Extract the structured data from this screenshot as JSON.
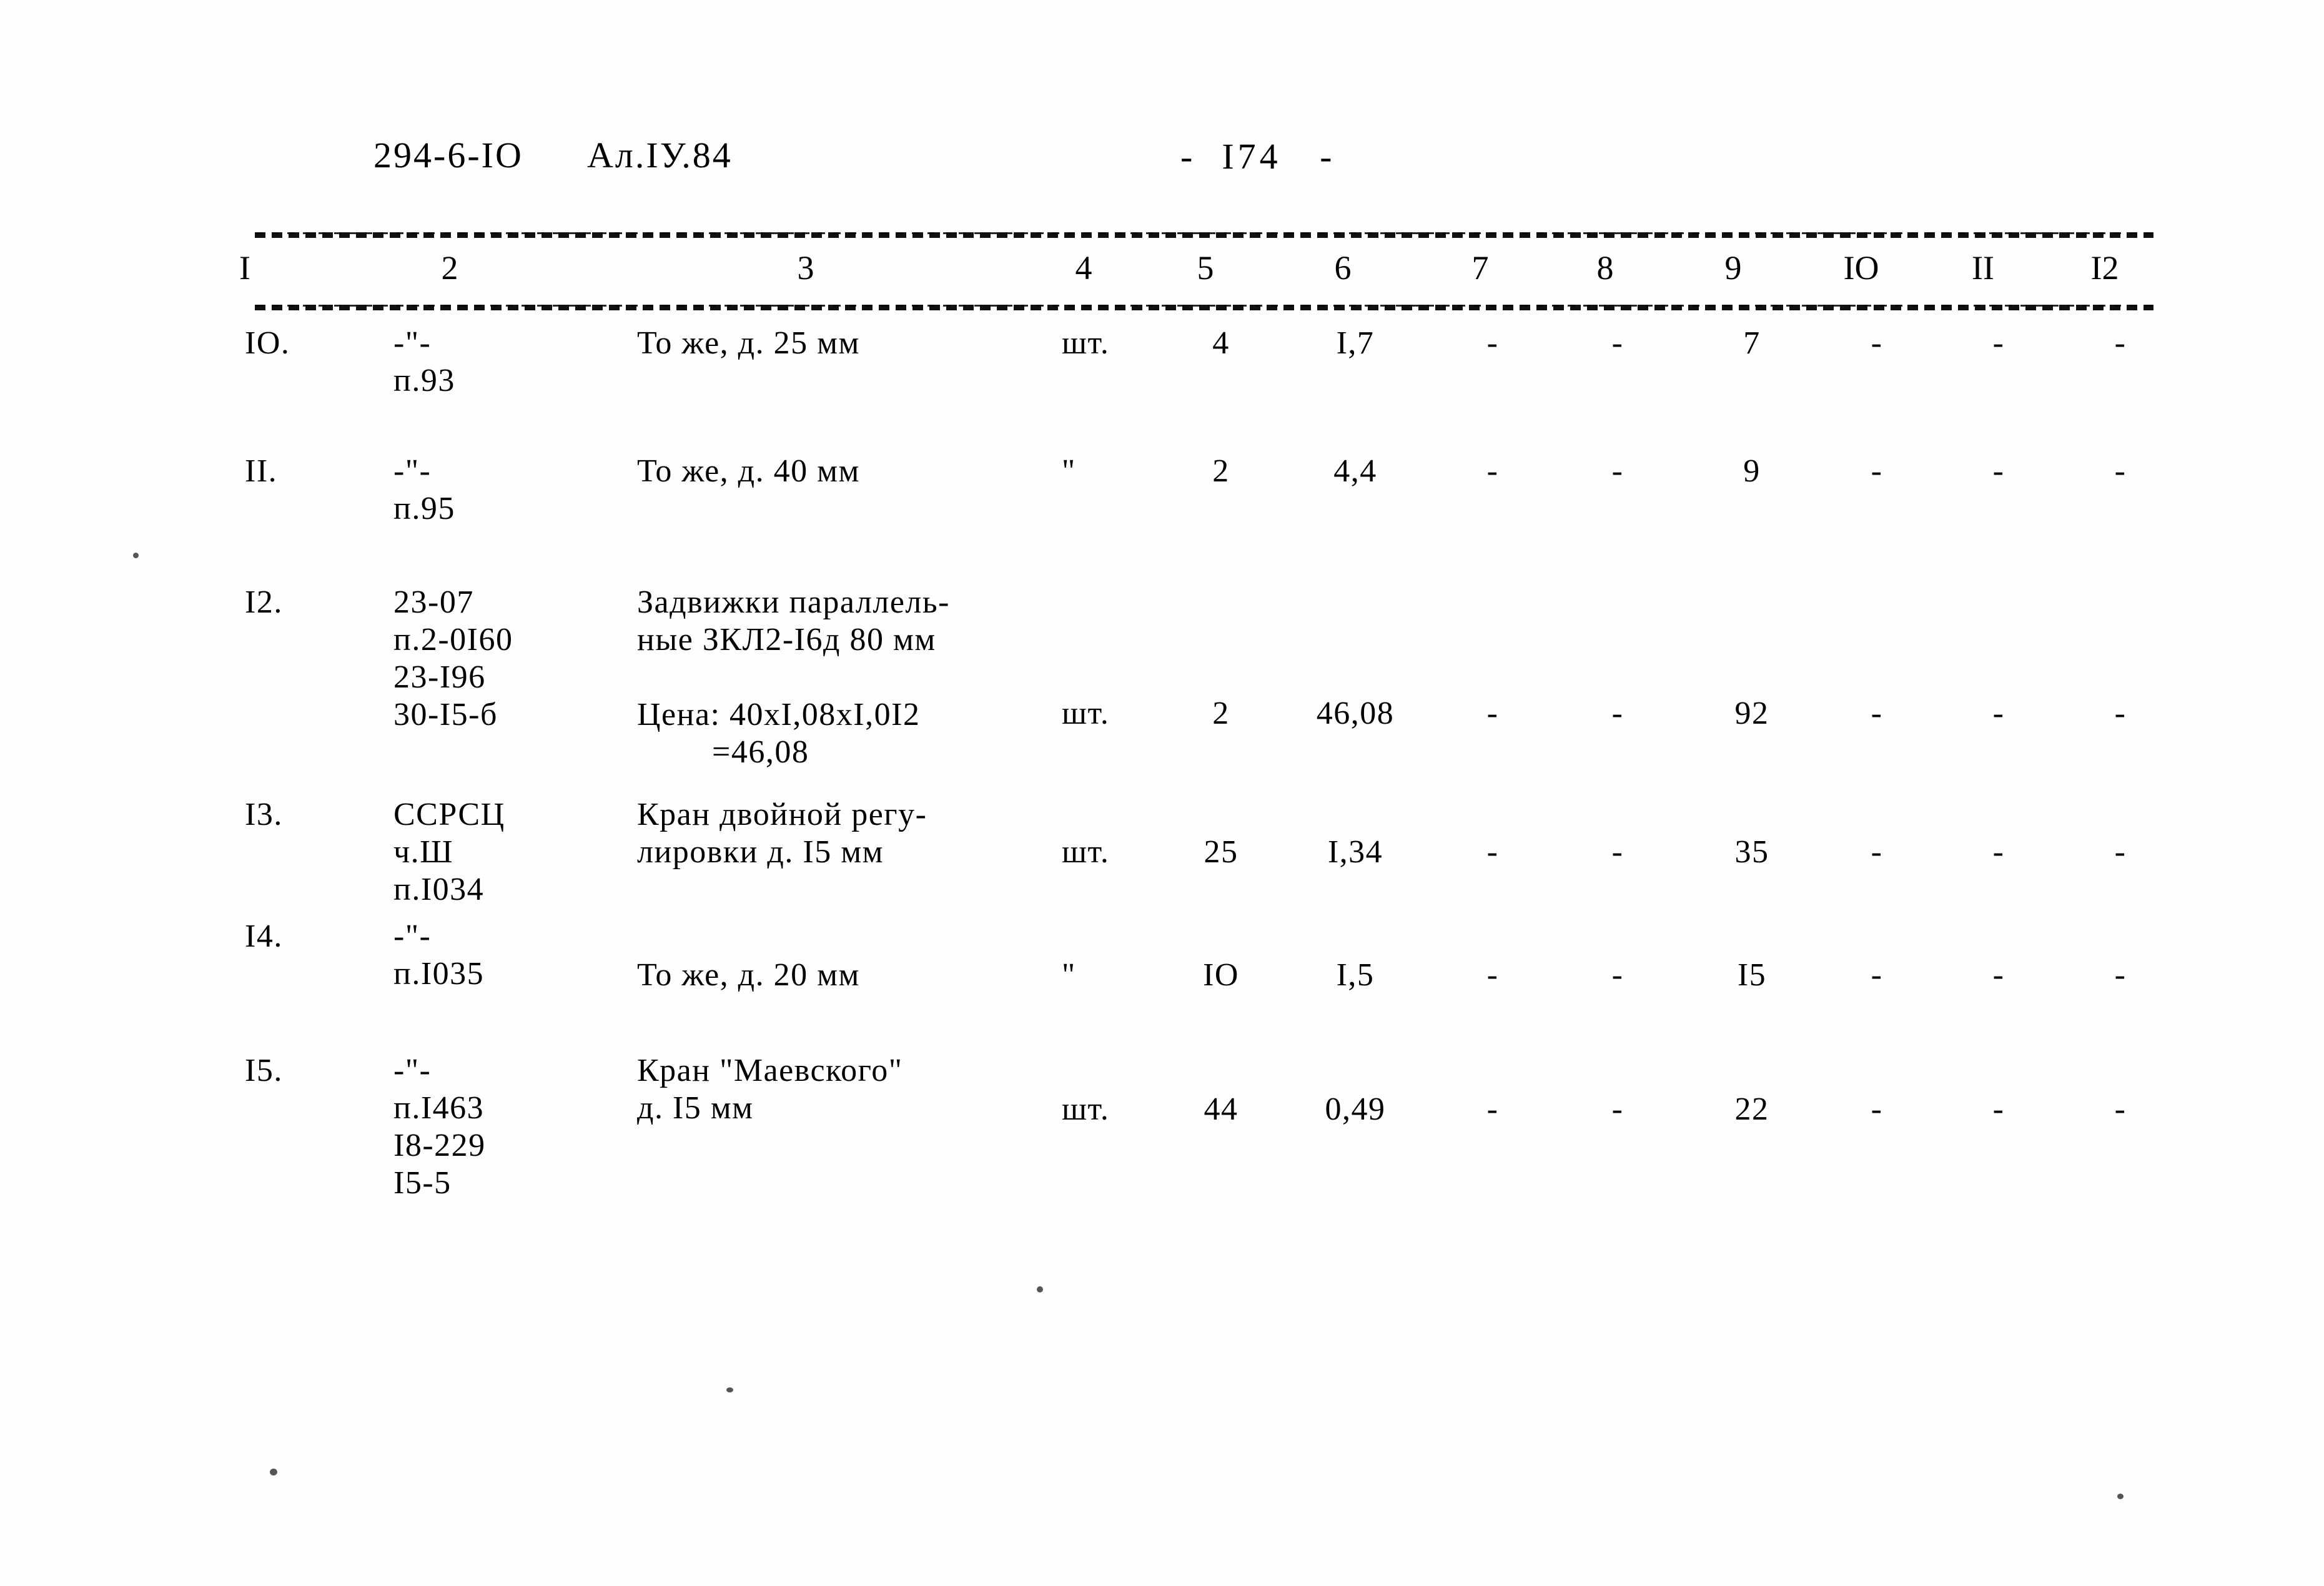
{
  "header": {
    "doc_code": "294-6-IO",
    "album": "Ал.IУ.84",
    "page_number": "-  I74   -"
  },
  "table": {
    "column_numbers": [
      "I",
      "2",
      "3",
      "4",
      "5",
      "6",
      "7",
      "8",
      "9",
      "IO",
      "II",
      "I2"
    ],
    "rows": [
      {
        "c1": "IO.",
        "c2": "-\"-\nп.93",
        "c3": "То же, д. 25 мм",
        "c4": "шт.",
        "c5": "4",
        "c6": "I,7",
        "c7": "-",
        "c8": "-",
        "c9": "7",
        "c10": "-",
        "c11": "-",
        "c12": "-"
      },
      {
        "c1": "II.",
        "c2": "-\"-\nп.95",
        "c3": "То же, д. 40 мм",
        "c4": "\"",
        "c5": "2",
        "c6": "4,4",
        "c7": "-",
        "c8": "-",
        "c9": "9",
        "c10": "-",
        "c11": "-",
        "c12": "-"
      },
      {
        "c1": "I2.",
        "c2": "23-07\nп.2-0I60\n23-I96\n30-I5-б",
        "c3": "Задвижки параллель-\nные ЗКЛ2-I6д 80 мм",
        "c3_price_label": "Цена: 40хI,08хI,0I2",
        "c3_price_sum": "=46,08",
        "c4": "шт.",
        "c5": "2",
        "c6": "46,08",
        "c7": "-",
        "c8": "-",
        "c9": "92",
        "c10": "-",
        "c11": "-",
        "c12": "-"
      },
      {
        "c1": "I3.",
        "c2": "ССРСЦ\nч.Ш\nп.I034",
        "c3": "Кран двойной регу-\nлировки д. I5 мм",
        "c4": "шт.",
        "c5": "25",
        "c6": "I,34",
        "c7": "-",
        "c8": "-",
        "c9": "35",
        "c10": "-",
        "c11": "-",
        "c12": "-"
      },
      {
        "c1": "I4.",
        "c2": "-\"-\nп.I035",
        "c3": "То же, д. 20 мм",
        "c4": "\"",
        "c5": "IO",
        "c6": "I,5",
        "c7": "-",
        "c8": "-",
        "c9": "I5",
        "c10": "-",
        "c11": "-",
        "c12": "-"
      },
      {
        "c1": "I5.",
        "c2": "-\"-\nп.I463\nI8-229\nI5-5",
        "c3": "Кран \"Маевского\"\nд. I5 мм",
        "c4": "шт.",
        "c5": "44",
        "c6": "0,49",
        "c7": "-",
        "c8": "-",
        "c9": "22",
        "c10": "-",
        "c11": "-",
        "c12": "-"
      }
    ]
  }
}
